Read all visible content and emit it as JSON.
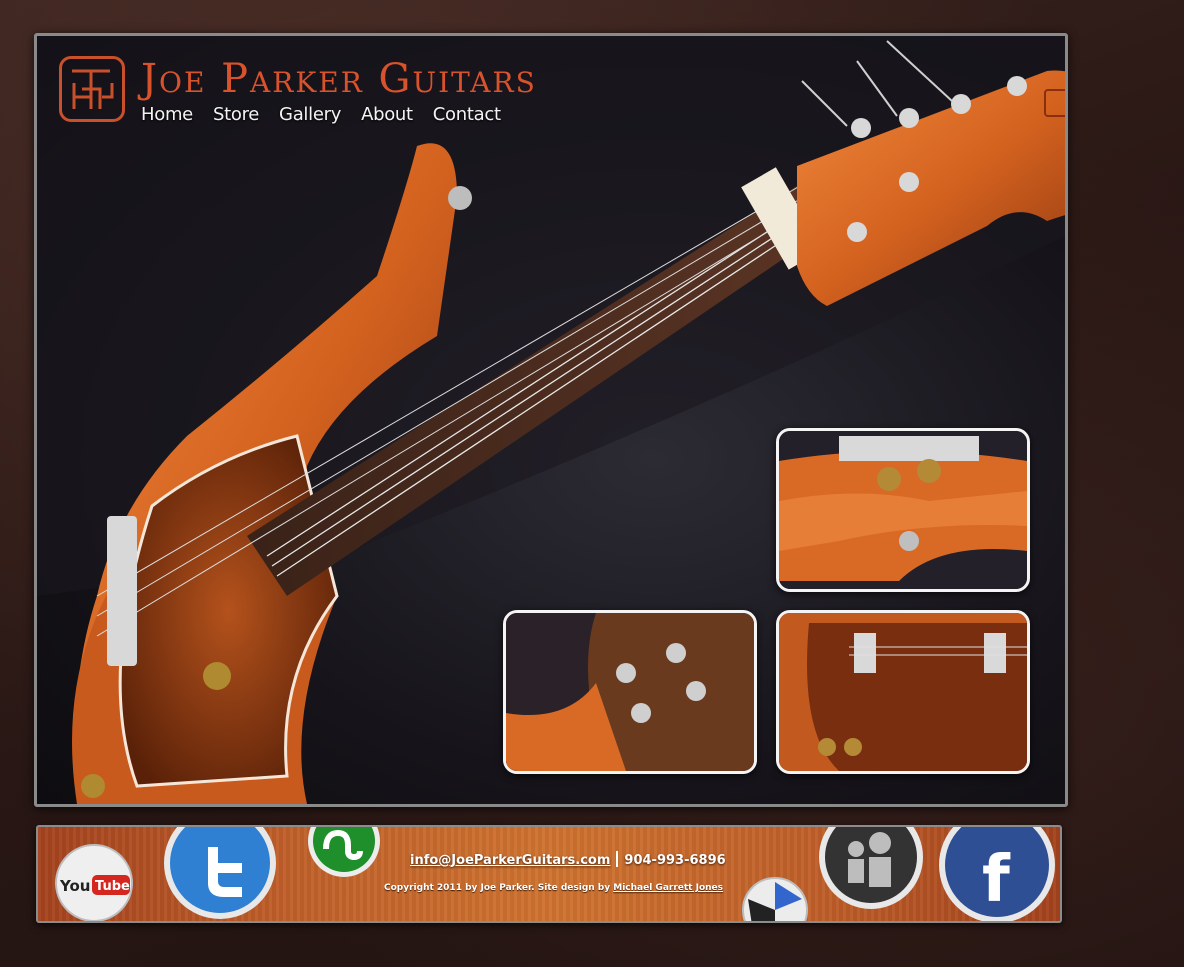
{
  "brand": {
    "title": "Joe Parker Guitars",
    "logo_icon": "jpg-monogram-icon",
    "accent_color": "#d8532c"
  },
  "nav": {
    "items": [
      {
        "label": "Home"
      },
      {
        "label": "Store"
      },
      {
        "label": "Gallery"
      },
      {
        "label": "About"
      },
      {
        "label": "Contact"
      }
    ]
  },
  "gallery": {
    "thumbnails": [
      {
        "icon": "guitar-body-closeup-image"
      },
      {
        "icon": "guitar-neck-plate-image"
      },
      {
        "icon": "guitar-pickguard-image"
      }
    ]
  },
  "footer": {
    "email": "info@JoeParkerGuitars.com",
    "phone": "904-993-6896",
    "copyright": "Copyright 2011 by Joe Parker. Site design by ",
    "designer": "Michael Garrett Jones",
    "social": [
      {
        "name": "youtube-icon",
        "label_you": "You",
        "label_tube": "Tube"
      },
      {
        "name": "twitter-icon"
      },
      {
        "name": "stumbleupon-icon"
      },
      {
        "name": "delicious-icon"
      },
      {
        "name": "myspace-icon"
      },
      {
        "name": "facebook-icon",
        "glyph": "f"
      }
    ]
  }
}
